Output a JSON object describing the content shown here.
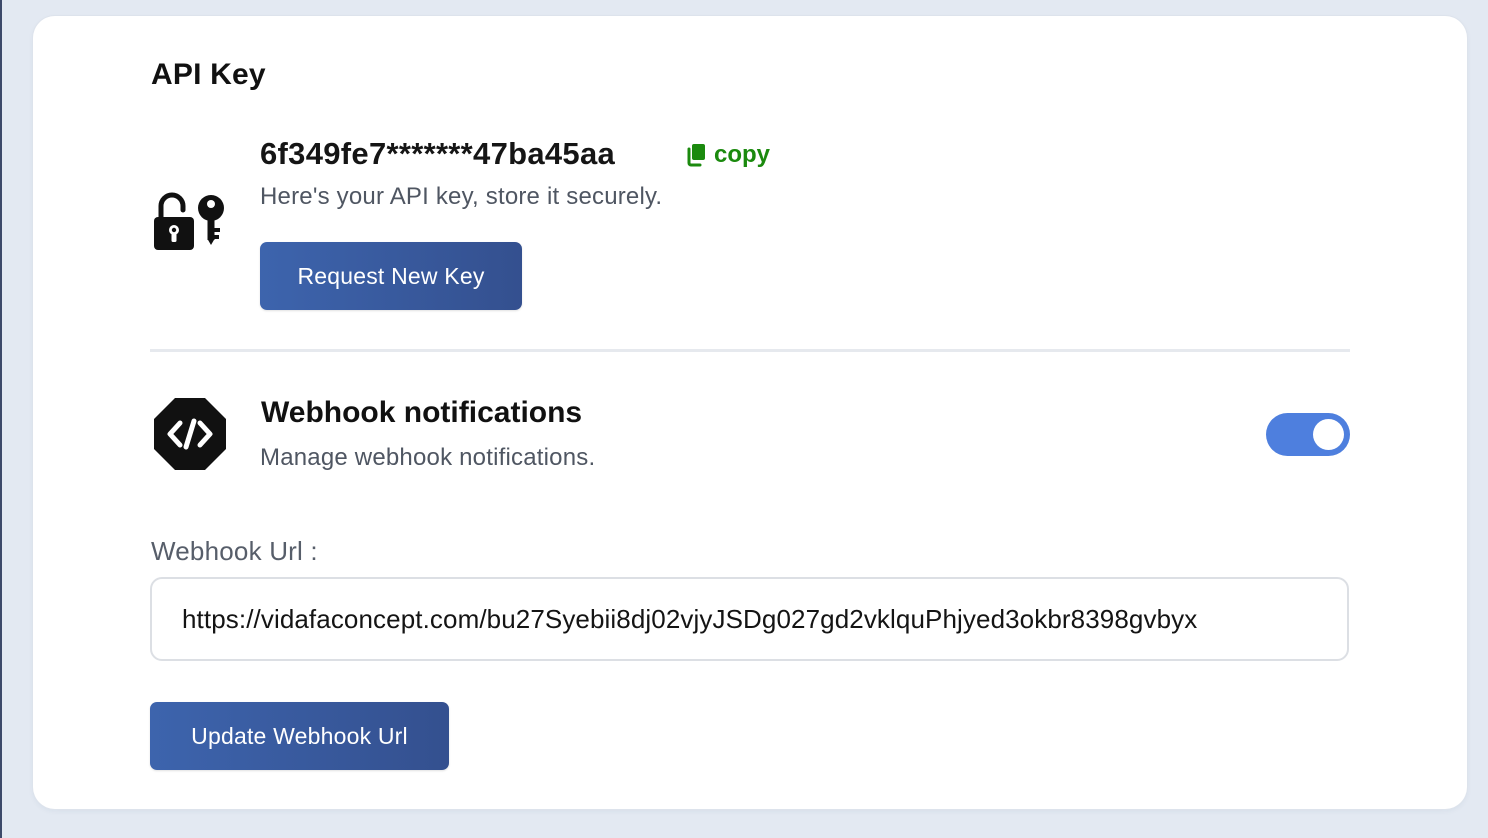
{
  "api_key_section": {
    "title": "API Key",
    "key_value": "6f349fe7*******47ba45aa",
    "copy_label": "copy",
    "hint": "Here's your API key, store it securely.",
    "request_button_label": "Request New Key",
    "icon": "lock-key-icon"
  },
  "webhook_section": {
    "title": "Webhook notifications",
    "description": "Manage webhook notifications.",
    "toggle_enabled": true,
    "icon": "code-icon",
    "url_label": "Webhook Url :",
    "url_value": "https://vidafaconcept.com/bu27Syebii8dj02vjyJSDg027gd2vklquPhjyed3okbr8398gvbyx",
    "update_button_label": "Update Webhook Url"
  },
  "colors": {
    "page_background": "#e3e9f2",
    "card_background": "#ffffff",
    "button_primary": "#3d64ad",
    "copy_green": "#1b8a0e",
    "toggle_on": "#4e7fde",
    "muted_text": "#4f5662"
  }
}
